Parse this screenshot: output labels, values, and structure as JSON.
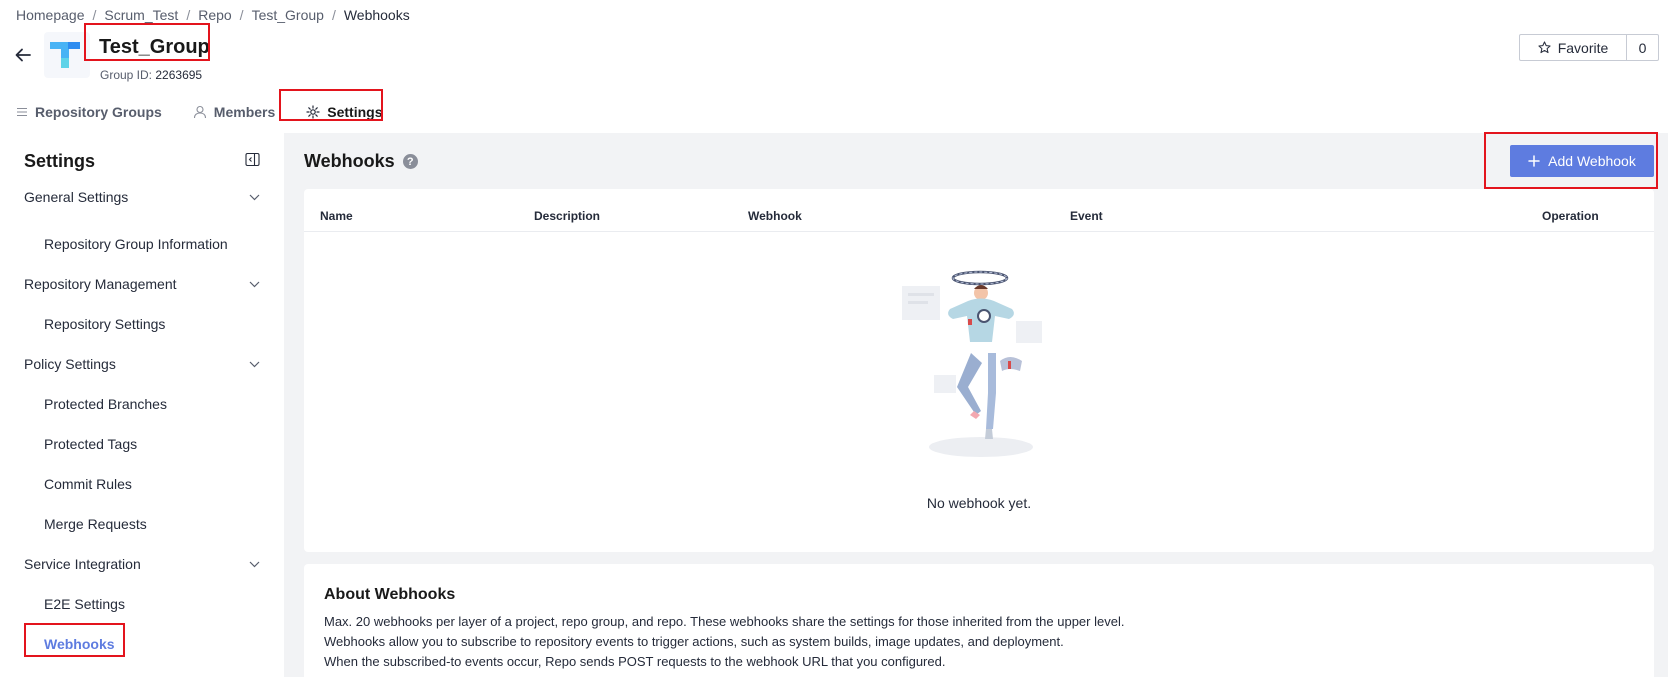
{
  "breadcrumb": [
    "Homepage",
    "Scrum_Test",
    "Repo",
    "Test_Group",
    "Webhooks"
  ],
  "group": {
    "name": "Test_Group",
    "id_label": "Group ID:",
    "id_value": "2263695"
  },
  "favorite": {
    "label": "Favorite",
    "count": "0"
  },
  "tabs": [
    {
      "label": "Repository Groups",
      "icon": "list-icon"
    },
    {
      "label": "Members",
      "icon": "user-icon"
    },
    {
      "label": "Settings",
      "icon": "gear-icon",
      "active": true
    }
  ],
  "sidebar": {
    "title": "Settings",
    "groups": [
      {
        "label": "General Settings",
        "items": [
          "Repository Group Information"
        ]
      },
      {
        "label": "Repository Management",
        "items": [
          "Repository Settings"
        ]
      },
      {
        "label": "Policy Settings",
        "items": [
          "Protected Branches",
          "Protected Tags",
          "Commit Rules",
          "Merge Requests"
        ]
      },
      {
        "label": "Service Integration",
        "items": [
          "E2E Settings",
          "Webhooks"
        ]
      }
    ],
    "active_item": "Webhooks"
  },
  "main": {
    "title": "Webhooks",
    "add_button": "Add Webhook",
    "columns": [
      "Name",
      "Description",
      "Webhook",
      "Event",
      "Operation"
    ],
    "empty_text": "No webhook yet."
  },
  "about": {
    "title": "About Webhooks",
    "lines": [
      "Max. 20 webhooks per layer of a project, repo group, and repo. These webhooks share the settings for those inherited from the upper level.",
      "Webhooks allow you to subscribe to repository events to trigger actions, such as system builds, image updates, and deployment.",
      "When the subscribed-to events occur, Repo sends POST requests to the webhook URL that you configured."
    ]
  },
  "colors": {
    "accent": "#5e7ce0",
    "highlight_box": "#e3141d",
    "content_bg": "#f2f3f5"
  }
}
